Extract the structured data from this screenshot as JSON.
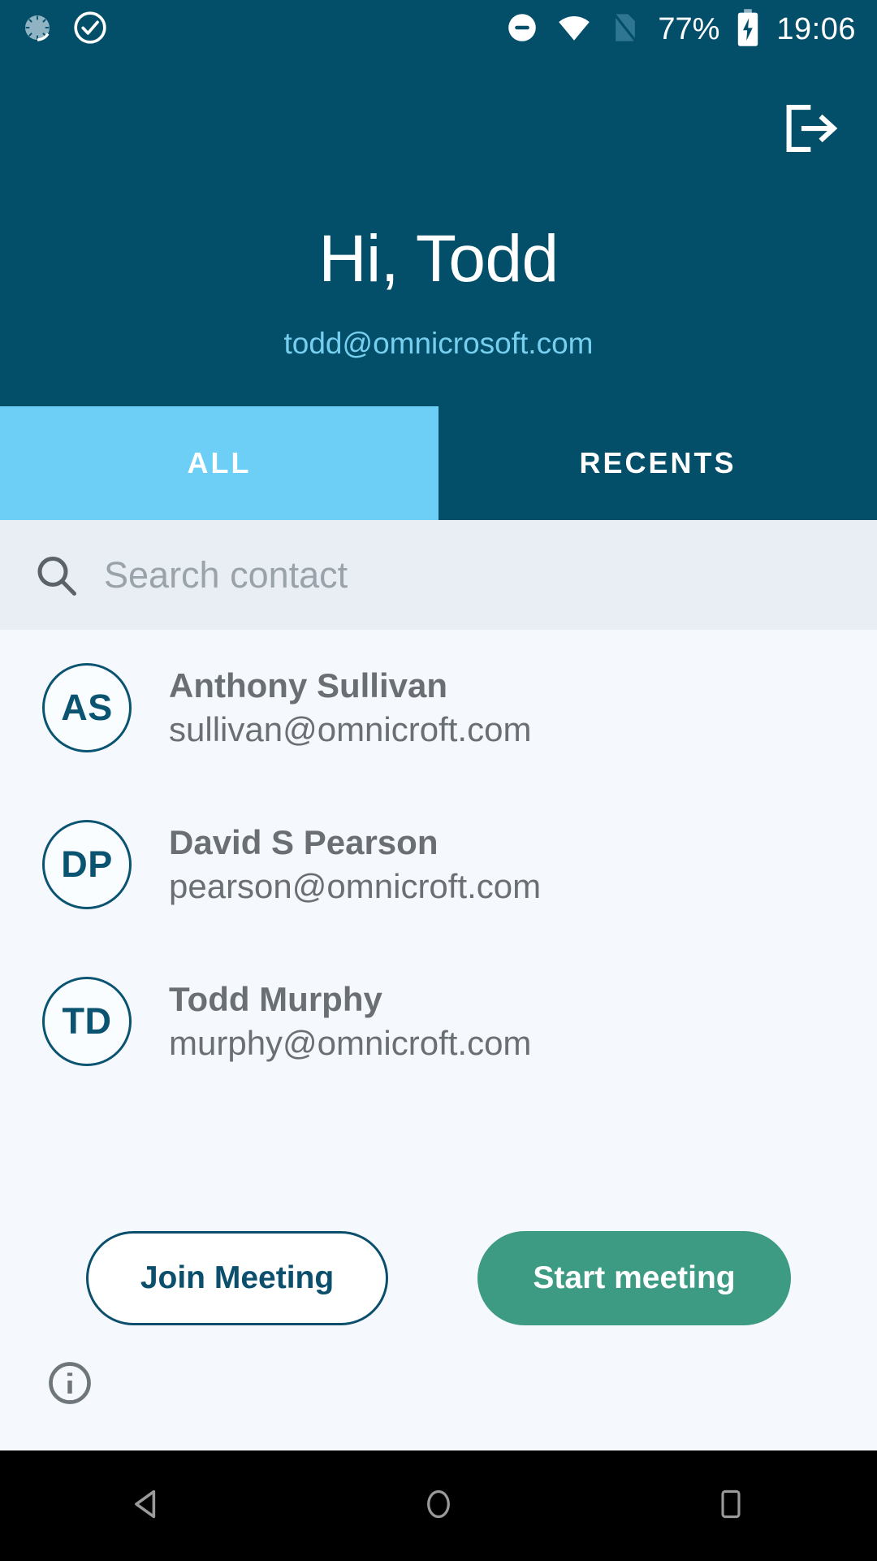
{
  "status_bar": {
    "icons_left": [
      "sync-spinner-icon",
      "check-circle-icon"
    ],
    "icons_right": [
      "do-not-disturb-icon",
      "wifi-icon",
      "no-sim-icon",
      "battery-charging-icon"
    ],
    "battery_percent": "77%",
    "time": "19:06"
  },
  "header": {
    "logout_icon": "logout-icon",
    "greeting": "Hi, Todd",
    "email": "todd@omnicrosoft.com",
    "background_color": "#034E68"
  },
  "tabs": [
    {
      "label": "ALL",
      "active": true
    },
    {
      "label": "RECENTS",
      "active": false
    }
  ],
  "search": {
    "icon": "search-icon",
    "placeholder": "Search contact",
    "value": ""
  },
  "contacts": [
    {
      "initials": "AS",
      "name": "Anthony Sullivan",
      "email": "sullivan@omnicroft.com"
    },
    {
      "initials": "DP",
      "name": "David S Pearson",
      "email": "pearson@omnicroft.com"
    },
    {
      "initials": "TD",
      "name": "Todd Murphy",
      "email": "murphy@omnicroft.com"
    }
  ],
  "actions": {
    "join_label": "Join Meeting",
    "start_label": "Start meeting",
    "start_color": "#3C9B82",
    "join_border_color": "#0B4F6C"
  },
  "info": {
    "icon": "info-icon"
  },
  "navbar": {
    "back": "back-triangle-icon",
    "home": "home-circle-icon",
    "recents": "recents-square-icon"
  }
}
